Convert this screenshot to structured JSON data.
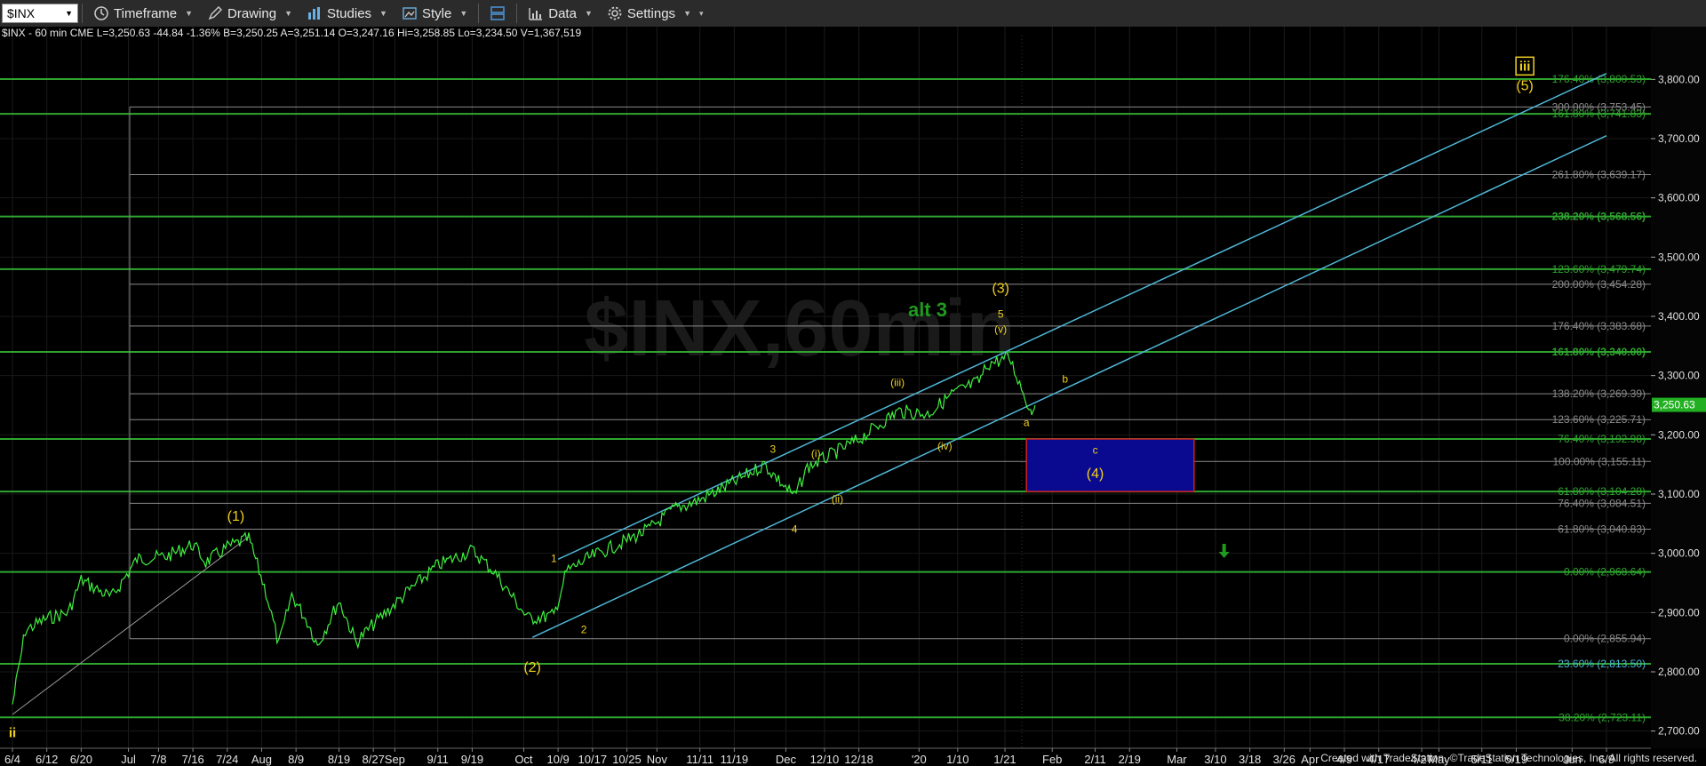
{
  "toolbar": {
    "symbol": "$INX",
    "timeframe_label": "Timeframe",
    "drawing_label": "Drawing",
    "studies_label": "Studies",
    "style_label": "Style",
    "data_label": "Data",
    "settings_label": "Settings"
  },
  "status_line": "$INX - 60 min  CME  L=3,250.63  -44.84  -1.36%  B=3,250.25  A=3,251.14  O=3,247.16  Hi=3,258.85  Lo=3,234.50  V=1,367,519",
  "footer": "Created with TradeStation. ©TradeStation Technologies, Inc. All rights reserved.",
  "colors": {
    "price": "#3ff03f",
    "green_line": "#2fa52f",
    "gray_line": "#8a8a8a",
    "channel": "#4fb6d6",
    "wave_label": "#f0d020",
    "alt_label": "#1f9a1f",
    "target_box": "#0a0a90",
    "target_border": "#d02020",
    "last_price_tag": "#22b022"
  },
  "chart_data": {
    "type": "line",
    "title": "$INX - 60 min",
    "ylim": [
      2680,
      3880
    ],
    "y_ticks": [
      "2,700.00",
      "2,800.00",
      "2,900.00",
      "3,000.00",
      "3,100.00",
      "3,200.00",
      "3,300.00",
      "3,400.00",
      "3,500.00",
      "3,600.00",
      "3,700.00",
      "3,800.00"
    ],
    "x_ticks": [
      "6/4",
      "6/12",
      "6/20",
      "Jul",
      "7/8",
      "7/16",
      "7/24",
      "Aug",
      "8/9",
      "8/19",
      "8/27",
      "Sep",
      "9/11",
      "9/19",
      "Oct",
      "10/9",
      "10/17",
      "10/25",
      "Nov",
      "11/11",
      "11/19",
      "Dec",
      "12/10",
      "12/18",
      "'20",
      "1/10",
      "1/21",
      "Feb",
      "2/11",
      "2/19",
      "Mar",
      "3/10",
      "3/18",
      "3/26",
      "Apr",
      "4/9",
      "4/17",
      "4/27",
      "May",
      "5/11",
      "5/19",
      "Jun",
      "6/9"
    ],
    "last_price": "3,250.63",
    "last_value": 3250.63,
    "price_series": [
      [
        "6/4",
        2745
      ],
      [
        "6/7",
        2870
      ],
      [
        "6/12",
        2890
      ],
      [
        "6/17",
        2900
      ],
      [
        "6/20",
        2955
      ],
      [
        "6/27",
        2925
      ],
      [
        "7/3",
        2990
      ],
      [
        "7/10",
        2995
      ],
      [
        "7/16",
        3015
      ],
      [
        "7/19",
        2985
      ],
      [
        "7/24",
        3010
      ],
      [
        "7/29",
        3025
      ],
      [
        "8/2",
        2935
      ],
      [
        "8/5",
        2845
      ],
      [
        "8/8",
        2930
      ],
      [
        "8/12",
        2880
      ],
      [
        "8/14",
        2845
      ],
      [
        "8/19",
        2920
      ],
      [
        "8/23",
        2850
      ],
      [
        "8/27",
        2880
      ],
      [
        "9/4",
        2935
      ],
      [
        "9/11",
        2980
      ],
      [
        "9/19",
        3005
      ],
      [
        "9/24",
        2970
      ],
      [
        "10/2",
        2890
      ],
      [
        "10/8",
        2895
      ],
      [
        "10/11",
        2970
      ],
      [
        "10/17",
        2995
      ],
      [
        "10/25",
        3022
      ],
      [
        "10/30",
        3040
      ],
      [
        "11/5",
        3075
      ],
      [
        "11/11",
        3090
      ],
      [
        "11/19",
        3120
      ],
      [
        "11/26",
        3150
      ],
      [
        "12/3",
        3095
      ],
      [
        "12/6",
        3145
      ],
      [
        "12/12",
        3168
      ],
      [
        "12/18",
        3192
      ],
      [
        "12/27",
        3240
      ],
      [
        "1/3",
        3235
      ],
      [
        "1/9",
        3270
      ],
      [
        "1/15",
        3290
      ],
      [
        "1/17",
        3320
      ],
      [
        "1/22",
        3330
      ],
      [
        "1/24",
        3295
      ],
      [
        "1/27",
        3240
      ],
      [
        "1/28",
        3250
      ]
    ],
    "levels": [
      {
        "label": "176.40% (3,800.53)",
        "value": 3800.53,
        "line": "green_line",
        "text": "green_line"
      },
      {
        "label": "300.00% (3,753.45)",
        "value": 3753.45,
        "line": "gray_line",
        "text": "gray_line"
      },
      {
        "label": "161.80% (3,741.83)",
        "value": 3741.83,
        "line": "green_line",
        "text": "green_line"
      },
      {
        "label": "261.80% (3,639.17)",
        "value": 3639.17,
        "line": "gray_line",
        "text": "gray_line"
      },
      {
        "label": "238.20% (3,568.56)",
        "value": 3568.56,
        "line": "green_line",
        "text": "green_line"
      },
      {
        "label": "123.60% (3,479.74)",
        "value": 3479.74,
        "line": "green_line",
        "text": "green_line"
      },
      {
        "label": "200.00% (3,454.28)",
        "value": 3454.28,
        "line": "gray_line",
        "text": "gray_line"
      },
      {
        "label": "176.40% (3,383.68)",
        "value": 3383.68,
        "line": "gray_line",
        "text": "gray_line"
      },
      {
        "label": "161.80% (3,340.00)",
        "value": 3340.0,
        "line": "green_line",
        "text": "green_line"
      },
      {
        "label": "138.20% (3,269.39)",
        "value": 3269.39,
        "line": "gray_line",
        "text": "gray_line"
      },
      {
        "label": "123.60% (3,225.71)",
        "value": 3225.71,
        "line": "gray_line",
        "text": "gray_line"
      },
      {
        "label": "76.40% (3,192.98)",
        "value": 3192.98,
        "line": "green_line",
        "text": "green_line"
      },
      {
        "label": "100.00% (3,155.11)",
        "value": 3155.11,
        "line": "gray_line",
        "text": "gray_line"
      },
      {
        "label": "61.80% (3,104.28)",
        "value": 3104.28,
        "line": "green_line",
        "text": "green_line"
      },
      {
        "label": "76.40% (3,084.51)",
        "value": 3084.51,
        "line": "gray_line",
        "text": "gray_line"
      },
      {
        "label": "61.80% (3,040.83)",
        "value": 3040.83,
        "line": "gray_line",
        "text": "gray_line"
      },
      {
        "label": "0.00% (2,968.64)",
        "value": 2968.64,
        "line": "green_line",
        "text": "green_line"
      },
      {
        "label": "0.00% (2,855.94)",
        "value": 2855.94,
        "line": "gray_line",
        "text": "gray_line"
      },
      {
        "label": "23.60% (2,813.50)",
        "value": 2813.5,
        "line": "green_line",
        "text": "channel"
      },
      {
        "label": "38.20% (2,723.11)",
        "value": 2723.11,
        "line": "green_line",
        "text": "green_line"
      }
    ],
    "channel_lines": [
      {
        "from": [
          "10/9",
          2990
        ],
        "to": [
          "6/9",
          3810
        ]
      },
      {
        "from": [
          "10/3",
          2858
        ],
        "to": [
          "6/9",
          3705
        ]
      }
    ],
    "wave_labels": [
      {
        "text": "ii",
        "at": [
          "6/4",
          2690
        ]
      },
      {
        "text": "(1)",
        "at": [
          "7/26",
          3055
        ]
      },
      {
        "text": "(2)",
        "at": [
          "10/3",
          2800
        ]
      },
      {
        "text": "1",
        "at": [
          "10/8",
          2985
        ]
      },
      {
        "text": "2",
        "at": [
          "10/15",
          2865
        ]
      },
      {
        "text": "3",
        "at": [
          "11/28",
          3170
        ]
      },
      {
        "text": "4",
        "at": [
          "12/3",
          3035
        ]
      },
      {
        "text": "(i)",
        "at": [
          "12/8",
          3162
        ]
      },
      {
        "text": "(ii)",
        "at": [
          "12/13",
          3086
        ]
      },
      {
        "text": "(iii)",
        "at": [
          "12/27",
          3282
        ]
      },
      {
        "text": "(iv)",
        "at": [
          "1/7",
          3175
        ]
      },
      {
        "text": "(v)",
        "at": [
          "1/20",
          3372
        ]
      },
      {
        "text": "5",
        "at": [
          "1/20",
          3398
        ]
      },
      {
        "text": "(3)",
        "at": [
          "1/20",
          3440
        ]
      },
      {
        "text": "a",
        "at": [
          "1/26",
          3215
        ]
      },
      {
        "text": "b",
        "at": [
          "2/4",
          3288
        ]
      },
      {
        "text": "c",
        "at": [
          "2/11",
          3168
        ]
      },
      {
        "text": "(4)",
        "at": [
          "2/11",
          3127
        ]
      },
      {
        "text": "(5)",
        "at": [
          "5/21",
          3782
        ]
      },
      {
        "text": "iii",
        "at": [
          "5/21",
          3815
        ]
      }
    ],
    "alt_label": {
      "text": "alt 3",
      "at": [
        "1/3",
        3400
      ]
    },
    "target_boxes": [
      {
        "x0": "1/26",
        "x1": "3/5",
        "y0": 3104.28,
        "y1": 3192.98
      },
      {
        "x0": "5/8",
        "x1": "6/1",
        "y0": 3728,
        "y1": 3812
      }
    ],
    "arrow": {
      "at": [
        "3/12",
        2995
      ]
    },
    "watermark": "$INX,60min"
  }
}
